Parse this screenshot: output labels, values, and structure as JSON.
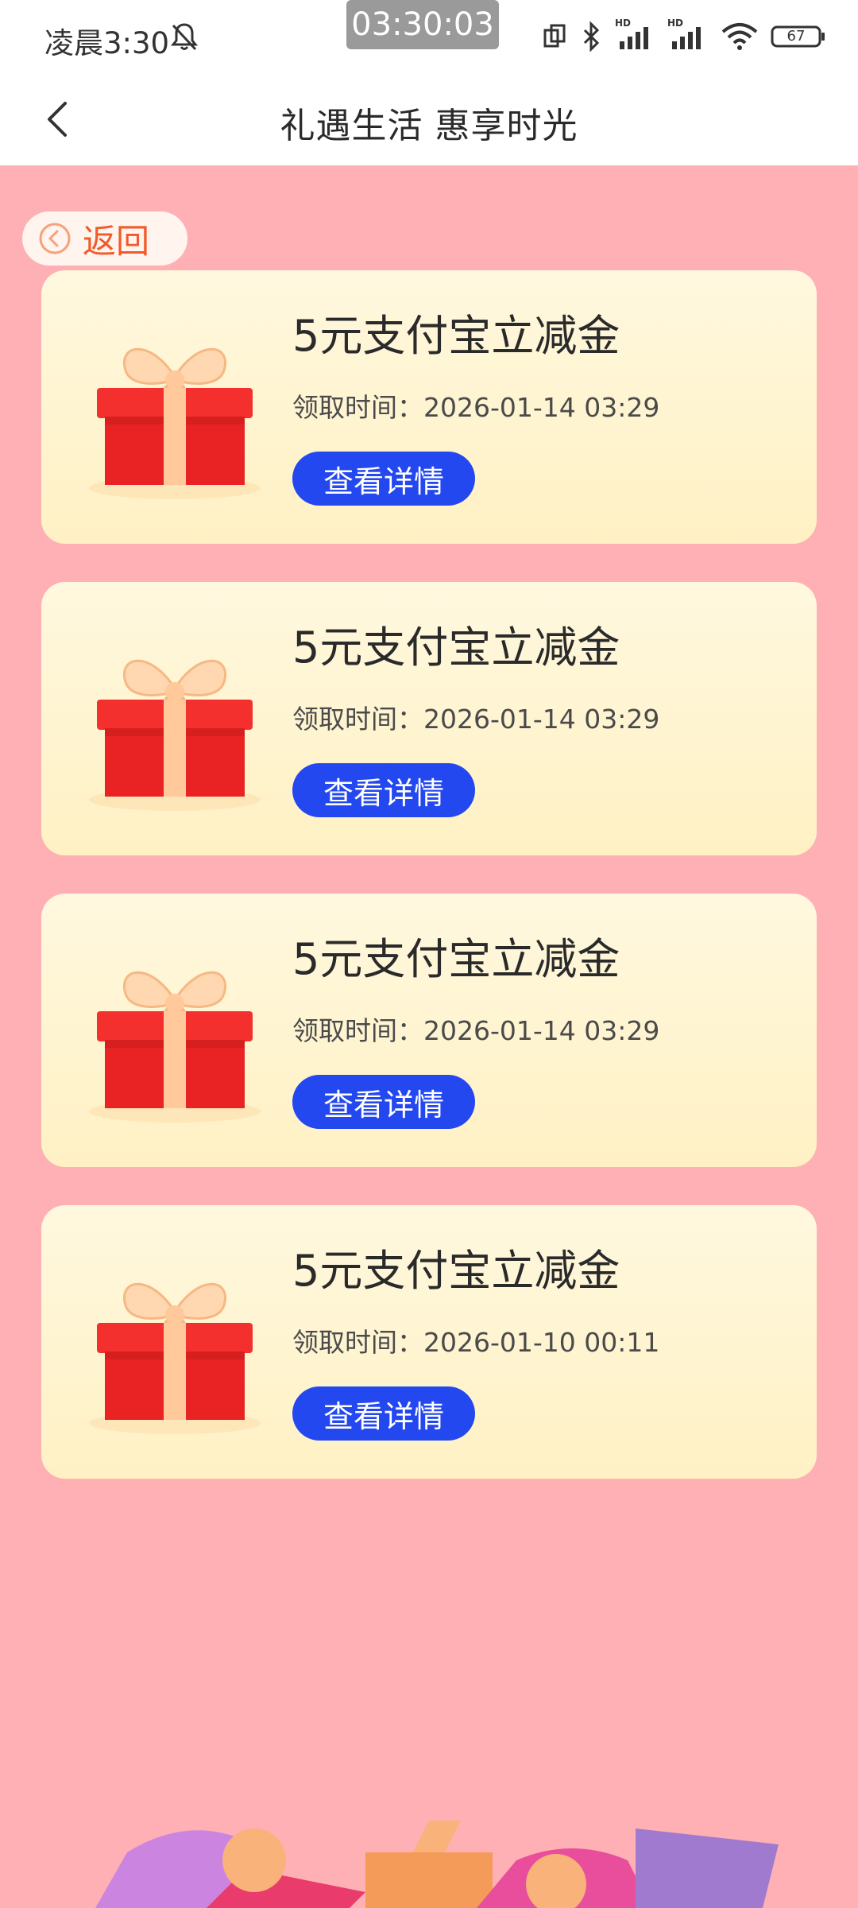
{
  "status_bar": {
    "time": "凌晨3:30",
    "clock": "03:30:03",
    "battery": "67",
    "hd1": "HD",
    "hd2": "HD"
  },
  "header": {
    "title": "礼遇生活 惠享时光"
  },
  "return_button": {
    "label": "返回"
  },
  "cards": [
    {
      "title": "5元支付宝立减金",
      "time": "领取时间：2026-01-14 03:29",
      "button": "查看详情"
    },
    {
      "title": "5元支付宝立减金",
      "time": "领取时间：2026-01-14 03:29",
      "button": "查看详情"
    },
    {
      "title": "5元支付宝立减金",
      "time": "领取时间：2026-01-14 03:29",
      "button": "查看详情"
    },
    {
      "title": "5元支付宝立减金",
      "time": "领取时间：2026-01-10 00:11",
      "button": "查看详情"
    }
  ],
  "colors": {
    "page_background": "#FFB0B4",
    "card_background": "#FFF4D2",
    "button": "#2448F0",
    "return_text": "#F25A2A",
    "gift_red": "#F3302D",
    "gift_ribbon": "#FFC99B"
  },
  "icons": [
    "mute-bell-icon",
    "screen-rotate-icon",
    "bluetooth-icon",
    "signal-icon",
    "wifi-icon",
    "battery-icon",
    "back-arrow-icon",
    "return-circle-icon",
    "gift-box-icon"
  ]
}
